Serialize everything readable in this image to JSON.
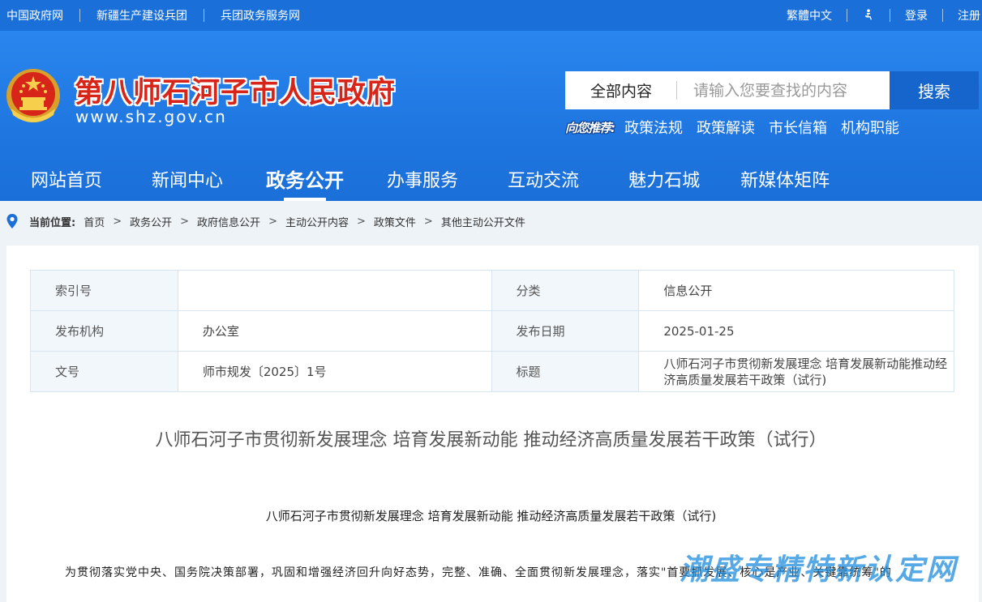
{
  "topbar": {
    "links": [
      "中国政府网",
      "新疆生产建设兵团",
      "兵团政务服务网"
    ],
    "traditional": "繁體中文",
    "login": "登录",
    "register": "注册"
  },
  "header": {
    "title": "第八师石河子市人民政府",
    "url": "www.shz.gov.cn",
    "search": {
      "scope": "全部内容",
      "placeholder": "请输入您要查找的内容",
      "button": "搜索"
    },
    "recommend": {
      "tag": "向您推荐:",
      "links": [
        "政策法规",
        "政策解读",
        "市长信箱",
        "机构职能"
      ]
    },
    "nav": [
      "网站首页",
      "新闻中心",
      "政务公开",
      "办事服务",
      "互动交流",
      "魅力石城",
      "新媒体矩阵"
    ],
    "nav_active": "政务公开"
  },
  "breadcrumb": {
    "lead": "当前位置:",
    "items": [
      "首页",
      "政务公开",
      "政府信息公开",
      "主动公开内容",
      "政策文件",
      "其他主动公开文件"
    ]
  },
  "meta": {
    "rows": [
      {
        "k1": "索引号",
        "v1": "",
        "k2": "分类",
        "v2": "信息公开"
      },
      {
        "k1": "发布机构",
        "v1": "办公室",
        "k2": "发布日期",
        "v2": "2025-01-25"
      },
      {
        "k1": "文号",
        "v1": "师市规发〔2025〕1号",
        "k2": "标题",
        "v2": "八师石河子市贯彻新发展理念 培育发展新动能推动经济高质量发展若干政策（试行)"
      }
    ]
  },
  "document": {
    "title": "八师石河子市贯彻新发展理念 培育发展新动能 推动经济高质量发展若干政策（试行）",
    "subtitle": "八师石河子市贯彻新发展理念 培育发展新动能 推动经济高质量发展若干政策（试行)",
    "paragraph": "为贯彻落实党中央、国务院决策部署，巩固和增强经济回升向好态势，完整、准确、全面贯彻新发展理念，落实\"首要抓发展、核心是产业、关键靠统筹\"的"
  },
  "watermark": "潮盛专精特新认定网",
  "colors": {
    "topbar": "#1a6fd8",
    "header": "#2a86ee",
    "title_red": "#d8251a",
    "search_button": "#1565cc"
  }
}
